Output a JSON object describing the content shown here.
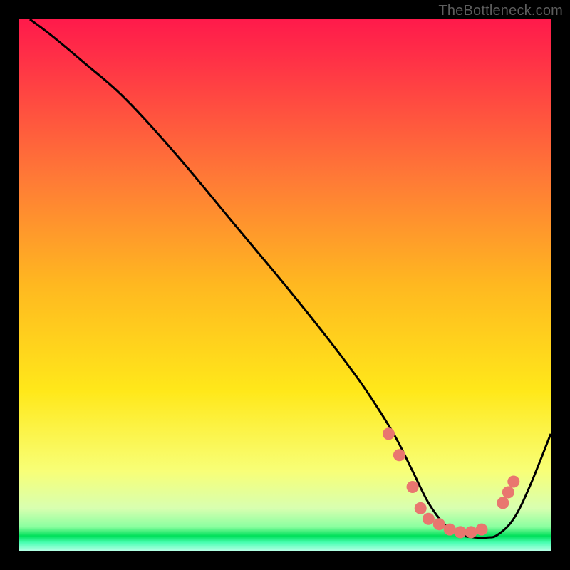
{
  "attribution": "TheBottleneck.com",
  "colors": {
    "bg": "#000000",
    "gradient_top": "#ff1a4b",
    "gradient_mid": "#ffdc24",
    "gradient_low": "#f4ffb4",
    "gradient_green": "#00e05a",
    "curve": "#000000",
    "dot": "#e9766f",
    "attribution": "#5d5d5d"
  },
  "chart_data": {
    "type": "line",
    "title": "",
    "xlabel": "",
    "ylabel": "",
    "xlim": [
      0,
      100
    ],
    "ylim": [
      0,
      100
    ],
    "curve": {
      "x": [
        2,
        6,
        12,
        20,
        30,
        40,
        50,
        58,
        64,
        68,
        71,
        74,
        77,
        80,
        83,
        86,
        88,
        90,
        93,
        96,
        100
      ],
      "y": [
        100,
        97,
        92,
        85,
        74,
        62,
        50,
        40,
        32,
        26,
        21,
        15,
        9,
        5,
        3,
        2.5,
        2.5,
        3,
        6,
        12,
        22
      ]
    },
    "dots": [
      {
        "x": 69.5,
        "y": 22
      },
      {
        "x": 71.5,
        "y": 18
      },
      {
        "x": 74,
        "y": 12
      },
      {
        "x": 75.5,
        "y": 8
      },
      {
        "x": 77,
        "y": 6
      },
      {
        "x": 79,
        "y": 5
      },
      {
        "x": 81,
        "y": 4
      },
      {
        "x": 83,
        "y": 3.5
      },
      {
        "x": 85,
        "y": 3.5
      },
      {
        "x": 87,
        "y": 4
      },
      {
        "x": 91,
        "y": 9
      },
      {
        "x": 92,
        "y": 11
      },
      {
        "x": 93,
        "y": 13
      }
    ],
    "gradient_stops": [
      {
        "offset": 0,
        "color": "#ff1a4b"
      },
      {
        "offset": 0.07,
        "color": "#ff2f47"
      },
      {
        "offset": 0.3,
        "color": "#ff7a36"
      },
      {
        "offset": 0.5,
        "color": "#ffb820"
      },
      {
        "offset": 0.7,
        "color": "#ffe81a"
      },
      {
        "offset": 0.85,
        "color": "#f8ff77"
      },
      {
        "offset": 0.92,
        "color": "#d8ffb0"
      },
      {
        "offset": 0.955,
        "color": "#8affa0"
      },
      {
        "offset": 0.972,
        "color": "#00e05a"
      },
      {
        "offset": 0.985,
        "color": "#4cffb4"
      },
      {
        "offset": 1.0,
        "color": "#b4ffe4"
      }
    ]
  }
}
